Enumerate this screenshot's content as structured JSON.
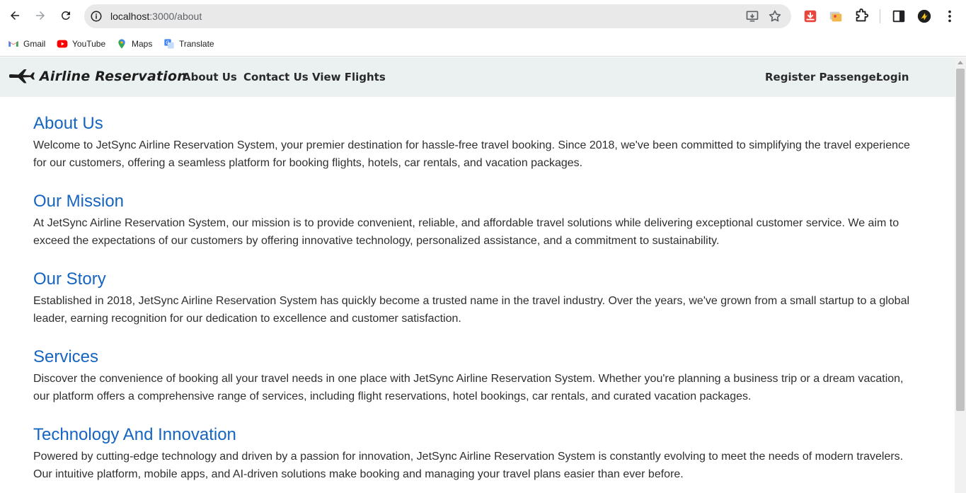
{
  "browser": {
    "url_host": "localhost",
    "url_path": ":3000/about",
    "bookmarks": [
      {
        "label": "Gmail",
        "icon": "gmail-icon"
      },
      {
        "label": "YouTube",
        "icon": "youtube-icon"
      },
      {
        "label": "Maps",
        "icon": "maps-icon"
      },
      {
        "label": "Translate",
        "icon": "translate-icon"
      }
    ]
  },
  "site": {
    "brand": "Airline Reservation",
    "nav_left": [
      "About Us",
      "Contact Us",
      "View Flights"
    ],
    "nav_right": [
      "Register Passenger",
      "Login"
    ]
  },
  "sections": [
    {
      "title": "About Us",
      "body": "Welcome to JetSync Airline Reservation System, your premier destination for hassle-free travel booking. Since 2018, we've been committed to simplifying the travel experience for our customers, offering a seamless platform for booking flights, hotels, car rentals, and vacation packages."
    },
    {
      "title": "Our Mission",
      "body": "At JetSync Airline Reservation System, our mission is to provide convenient, reliable, and affordable travel solutions while delivering exceptional customer service. We aim to exceed the expectations of our customers by offering innovative technology, personalized assistance, and a commitment to sustainability."
    },
    {
      "title": "Our Story",
      "body": "Established in 2018, JetSync Airline Reservation System has quickly become a trusted name in the travel industry. Over the years, we've grown from a small startup to a global leader, earning recognition for our dedication to excellence and customer satisfaction."
    },
    {
      "title": "Services",
      "body": "Discover the convenience of booking all your travel needs in one place with JetSync Airline Reservation System. Whether you're planning a business trip or a dream vacation, our platform offers a comprehensive range of services, including flight reservations, hotel bookings, car rentals, and curated vacation packages."
    },
    {
      "title": "Technology And Innovation",
      "body": "Powered by cutting-edge technology and driven by a passion for innovation, JetSync Airline Reservation System is constantly evolving to meet the needs of modern travelers. Our intuitive platform, mobile apps, and AI-driven solutions make booking and managing your travel plans easier than ever before."
    }
  ],
  "colors": {
    "heading": "#1565c0",
    "nav_bg": "#ebf1f1",
    "body_text": "#2f2f2f"
  }
}
